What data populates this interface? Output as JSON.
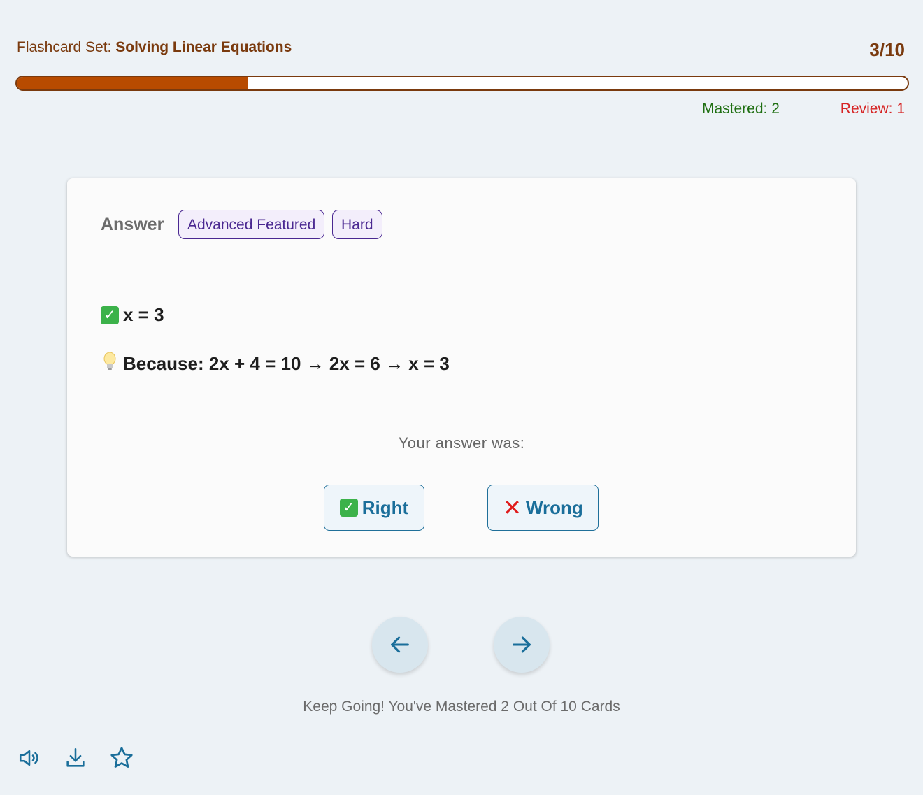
{
  "header": {
    "set_prefix": "Flashcard Set: ",
    "set_name": "Solving Linear Equations",
    "counter": "3/10"
  },
  "progress": {
    "fraction": 0.26
  },
  "stats": {
    "mastered": "Mastered: 2",
    "review": "Review: 1"
  },
  "card": {
    "label": "Answer",
    "tags": [
      "Advanced Featured",
      "Hard"
    ],
    "answer": "x = 3",
    "explanation": "Because: 2x + 4 = 10 → 2x = 6 → x = 3",
    "prompt": "Your answer was:",
    "right_label": "Right",
    "wrong_label": "Wrong"
  },
  "footer": {
    "message": "Keep Going! You've Mastered 2 Out Of 10 Cards"
  },
  "icons": {
    "prev": "arrow-left-icon",
    "next": "arrow-right-icon",
    "tools": [
      "speaker-icon",
      "download-icon",
      "star-icon"
    ]
  },
  "colors": {
    "accent": "#b84b00",
    "primary": "#1a6e9a",
    "mastered": "#1f6f12",
    "review": "#d62424"
  }
}
